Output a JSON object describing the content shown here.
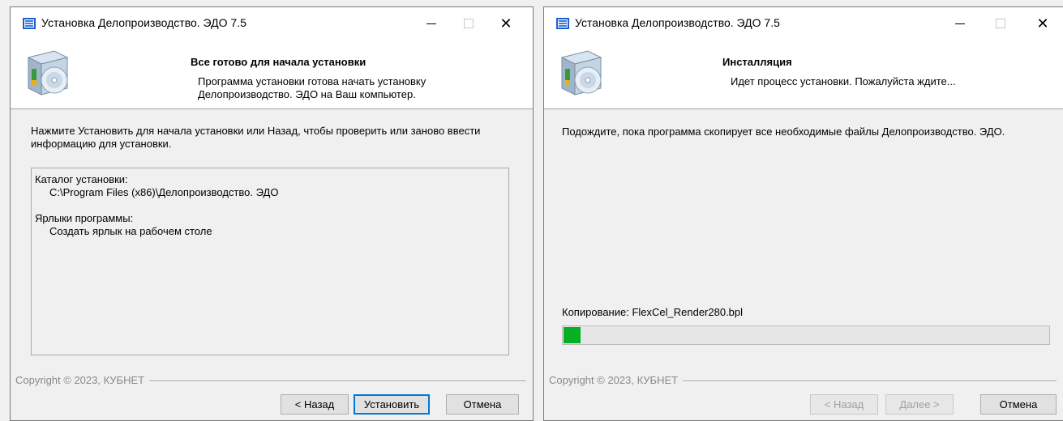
{
  "windows": [
    {
      "title": "Установка Делопроизводство. ЭДО 7.5",
      "header_title": "Все готово для начала установки",
      "header_subtitle": "Программа установки готова начать установку Делопроизводство. ЭДО на Ваш компьютер.",
      "body_text": "Нажмите Установить для начала установки или Назад, чтобы проверить или заново ввести информацию для установки.",
      "memo": {
        "dir_label": "Каталог установки:",
        "dir_value": "C:\\Program Files (x86)\\Делопроизводство. ЭДО",
        "shortcuts_label": "Ярлыки программы:",
        "shortcuts_value": "Создать ярлык на рабочем столе"
      },
      "copyright": "Copyright © 2023, КУБНЕТ",
      "buttons": {
        "back": "< Назад",
        "install": "Установить",
        "cancel": "Отмена"
      }
    },
    {
      "title": "Установка Делопроизводство. ЭДО 7.5",
      "header_title": "Инсталляция",
      "header_subtitle": "Идет процесс установки. Пожалуйста ждите...",
      "body_text": "Подождите, пока программа скопирует все необходимые файлы Делопроизводство. ЭДО.",
      "status": "Копирование: FlexCel_Render280.bpl",
      "progress_fraction": 0.035,
      "copyright": "Copyright © 2023, КУБНЕТ",
      "buttons": {
        "back": "< Назад",
        "next": "Далее >",
        "cancel": "Отмена"
      }
    }
  ],
  "icons": {
    "app": "installer-app-icon",
    "header": "installer-box-cd-icon",
    "close": "close-icon",
    "minimize": "minimize-icon",
    "maximize": "maximize-icon"
  },
  "colors": {
    "progress": "#06b025",
    "default_button_border": "#0078d7"
  }
}
